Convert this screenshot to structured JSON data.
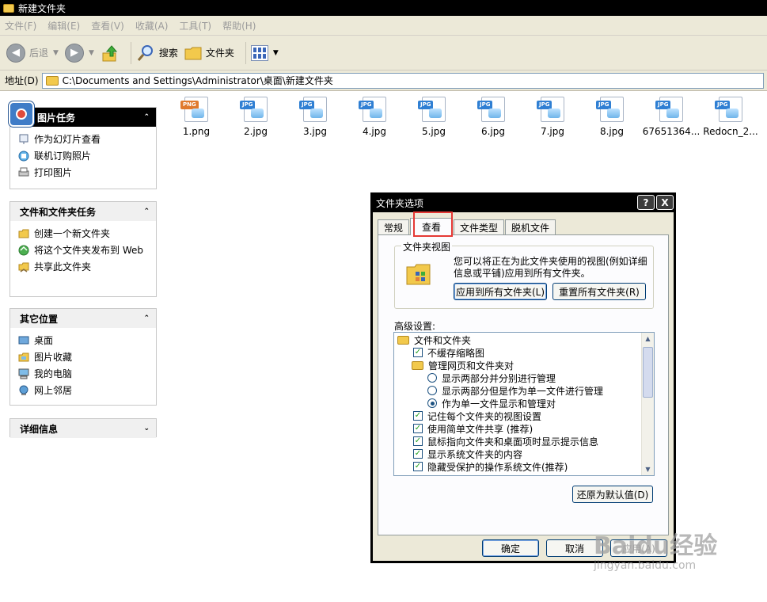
{
  "window": {
    "title": "新建文件夹"
  },
  "menu": [
    "文件(F)",
    "编辑(E)",
    "查看(V)",
    "收藏(A)",
    "工具(T)",
    "帮助(H)"
  ],
  "toolbar": {
    "back_label": "后退",
    "search_label": "搜索",
    "folders_label": "文件夹"
  },
  "address": {
    "label": "地址(D)",
    "path": "C:\\Documents and Settings\\Administrator\\桌面\\新建文件夹"
  },
  "picture_tasks": {
    "title": "图片任务",
    "items": [
      {
        "label": "作为幻灯片查看",
        "icon": "slideshow-icon"
      },
      {
        "label": "联机订购照片",
        "icon": "order-prints-icon"
      },
      {
        "label": "打印图片",
        "icon": "print-icon"
      }
    ]
  },
  "file_tasks": {
    "title": "文件和文件夹任务",
    "items": [
      {
        "label": "创建一个新文件夹",
        "icon": "new-folder-icon"
      },
      {
        "label": "将这个文件夹发布到 Web",
        "icon": "publish-web-icon"
      },
      {
        "label": "共享此文件夹",
        "icon": "share-folder-icon"
      }
    ]
  },
  "other_places": {
    "title": "其它位置",
    "items": [
      {
        "label": "桌面",
        "icon": "desktop-icon"
      },
      {
        "label": "图片收藏",
        "icon": "my-pictures-icon"
      },
      {
        "label": "我的电脑",
        "icon": "my-computer-icon"
      },
      {
        "label": "网上邻居",
        "icon": "network-places-icon"
      }
    ]
  },
  "details": {
    "title": "详细信息"
  },
  "files": [
    {
      "name": "1.png",
      "type": "PNG"
    },
    {
      "name": "2.jpg",
      "type": "JPG"
    },
    {
      "name": "3.jpg",
      "type": "JPG"
    },
    {
      "name": "4.jpg",
      "type": "JPG"
    },
    {
      "name": "5.jpg",
      "type": "JPG"
    },
    {
      "name": "6.jpg",
      "type": "JPG"
    },
    {
      "name": "7.jpg",
      "type": "JPG"
    },
    {
      "name": "8.jpg",
      "type": "JPG"
    },
    {
      "name": "67651364...",
      "type": "JPG"
    },
    {
      "name": "Redocn_2...",
      "type": "JPG"
    }
  ],
  "dialog": {
    "title": "文件夹选项",
    "help_label": "?",
    "close_label": "X",
    "tabs": [
      "常规",
      "查看",
      "文件类型",
      "脱机文件"
    ],
    "active_tab": "查看",
    "folder_views": {
      "legend": "文件夹视图",
      "description": "您可以将正在为此文件夹使用的视图(例如详细信息或平铺)应用到所有文件夹。",
      "apply_all": "应用到所有文件夹(L)",
      "reset_all": "重置所有文件夹(R)"
    },
    "advanced_label": "高级设置:",
    "settings": [
      {
        "label": "文件和文件夹",
        "kind": "folder",
        "checked": false
      },
      {
        "label": "不缓存缩略图",
        "kind": "checkbox",
        "checked": true
      },
      {
        "label": "管理网页和文件夹对",
        "kind": "folder",
        "checked": false
      },
      {
        "label": "显示两部分并分别进行管理",
        "kind": "radio",
        "checked": false
      },
      {
        "label": "显示两部分但是作为单一文件进行管理",
        "kind": "radio",
        "checked": false
      },
      {
        "label": "作为单一文件显示和管理对",
        "kind": "radio",
        "checked": true
      },
      {
        "label": "记住每个文件夹的视图设置",
        "kind": "checkbox",
        "checked": true
      },
      {
        "label": "使用简单文件共享 (推荐)",
        "kind": "checkbox",
        "checked": true
      },
      {
        "label": "鼠标指向文件夹和桌面项时显示提示信息",
        "kind": "checkbox",
        "checked": true
      },
      {
        "label": "显示系统文件夹的内容",
        "kind": "checkbox",
        "checked": true
      },
      {
        "label": "隐藏受保护的操作系统文件(推荐)",
        "kind": "checkbox",
        "checked": true
      }
    ],
    "restore_defaults": "还原为默认值(D)",
    "ok": "确定",
    "cancel": "取消",
    "apply": "应用(A)"
  },
  "watermark": {
    "main": "Baidu经验",
    "sub": "jingyan.baidu.com"
  }
}
